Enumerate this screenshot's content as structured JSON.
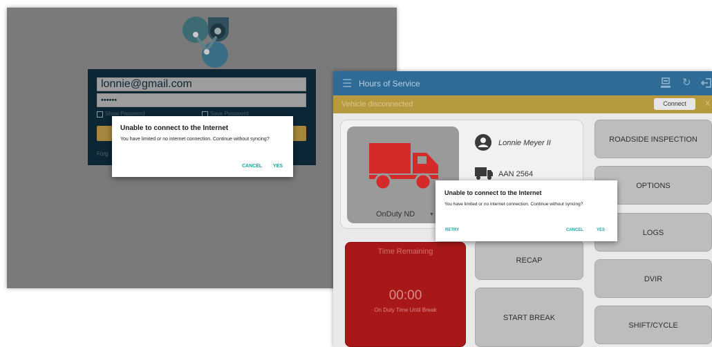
{
  "login_screen": {
    "email_value": "lonnie@gmail.com",
    "password_value": "••••••",
    "show_password_label": "Show Password",
    "save_password_label": "Save Password",
    "forgot_label": "Forg",
    "dialog": {
      "title": "Unable to connect to the Internet",
      "message": "You have limited or no internet connection. Continue without syncing?",
      "cancel_label": "CANCEL",
      "yes_label": "YES"
    }
  },
  "hos_screen": {
    "app_title": "Hours of Service",
    "status_text": "Vehicle disconnected",
    "connect_label": "Connect",
    "close_label": "X",
    "driver_name": "Lonnie Meyer II",
    "vehicle_id": "AAN 2564",
    "duty_status": "OnDuty ND",
    "dropdown_arrow": "▼",
    "time_remaining_label": "Time Remaining",
    "time_remaining_value": "00:00",
    "time_remaining_sub": "On Duty Time Until Break",
    "buttons": {
      "roadside": "ROADSIDE INSPECTION",
      "options": "OPTIONS",
      "logs": "LOGS",
      "recap": "RECAP",
      "dvir": "DVIR",
      "start_break": "START BREAK",
      "shift_cycle": "SHIFT/CYCLE"
    },
    "dialog": {
      "title": "Unable to connect to the Internet",
      "message": "You have limited or no internet connection. Continue without syncing?",
      "retry_label": "RETRY",
      "cancel_label": "CANCEL",
      "yes_label": "YES"
    }
  },
  "colors": {
    "app_bar": "#2e6c97",
    "status_bar": "#b89a3e",
    "accent": "#16a59c",
    "time_remaining_bg": "#a81818",
    "truck": "#d42a2a"
  }
}
